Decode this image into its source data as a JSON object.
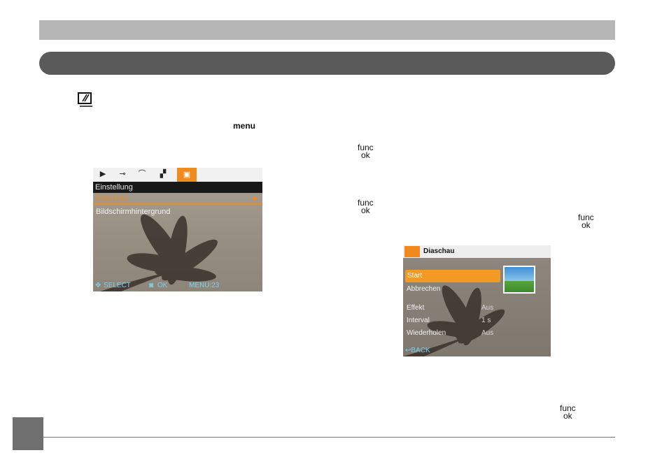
{
  "keys": {
    "menu": "menu",
    "func": "func",
    "ok": "ok"
  },
  "screen1": {
    "tab_icons": [
      "play-icon",
      "key-icon",
      "wrench-icon",
      "print-icon",
      "slideshow-icon"
    ],
    "title": "Einstellung",
    "items": [
      "Diaschau",
      "Bildschirmhintergrund"
    ],
    "footer": {
      "select": "SELECT",
      "ok": "OK",
      "menu": "MENU:23"
    }
  },
  "screen2": {
    "title": "Diaschau",
    "options": [
      "Start",
      "Abbrechen"
    ],
    "settings": [
      {
        "label": "Effekt",
        "value": "Aus"
      },
      {
        "label": "Interval",
        "value": "1 s"
      },
      {
        "label": "Wiederholen",
        "value": "Aus"
      }
    ],
    "back": "BACK"
  },
  "colors": {
    "accent": "#f08a1c",
    "pill": "#5a5a5a",
    "topbar": "#b6b6b6"
  }
}
